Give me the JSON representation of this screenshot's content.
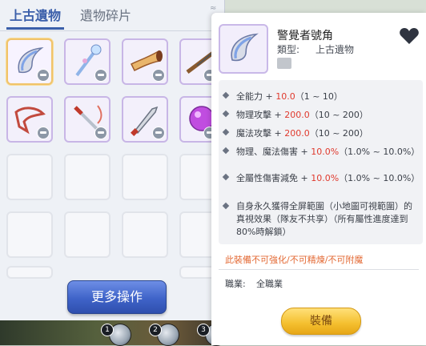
{
  "tabs": [
    {
      "label": "上古遺物",
      "active": true
    },
    {
      "label": "遺物碎片",
      "active": false
    }
  ],
  "inventory": {
    "items": [
      {
        "name": "horn-claw-icon",
        "selected": true
      },
      {
        "name": "crystal-wand-icon",
        "selected": false
      },
      {
        "name": "golden-horn-icon",
        "selected": false
      },
      {
        "name": "rifle-icon",
        "selected": false
      },
      {
        "name": "red-ribbon-icon",
        "selected": false
      },
      {
        "name": "twin-blade-icon",
        "selected": false
      },
      {
        "name": "curved-knife-icon",
        "selected": false
      },
      {
        "name": "purple-orb-icon",
        "selected": false
      }
    ],
    "more_button": "更多操作"
  },
  "skillbar": {
    "slots": [
      "1",
      "2",
      "3"
    ]
  },
  "detail": {
    "name": "警覺者號角",
    "type_label": "類型:",
    "type_value": "上古遺物",
    "stats": [
      {
        "prefix": "全能力 + ",
        "value": "10.0",
        "range": "（1 ~ 10）"
      },
      {
        "prefix": "物理攻擊 + ",
        "value": "200.0",
        "range": "（10 ~ 200）"
      },
      {
        "prefix": "魔法攻擊 + ",
        "value": "200.0",
        "range": "（10 ~ 200）"
      },
      {
        "prefix": "物理、魔法傷害 + ",
        "value": "10.0%",
        "range": "（1.0% ~ 10.0%）"
      },
      {
        "prefix": "全屬性傷害減免 + ",
        "value": "10.0%",
        "range": "（1.0% ~ 10.0%）"
      }
    ],
    "description": "自身永久獲得全屏範圍（小地圖可視範圍）的真視效果（隊友不共享）（所有屬性進度達到80%時解鎖）",
    "warning": "此裝備不可強化/不可精煉/不可附魔",
    "job_label": "職業:",
    "job_value": "全職業",
    "equip_button": "裝備"
  },
  "colors": {
    "accent": "#3b5faa",
    "stat_value": "#e03a2e",
    "warning": "#e36a35",
    "equip_button": "#f4bf2e",
    "more_button": "#3f63c8"
  }
}
